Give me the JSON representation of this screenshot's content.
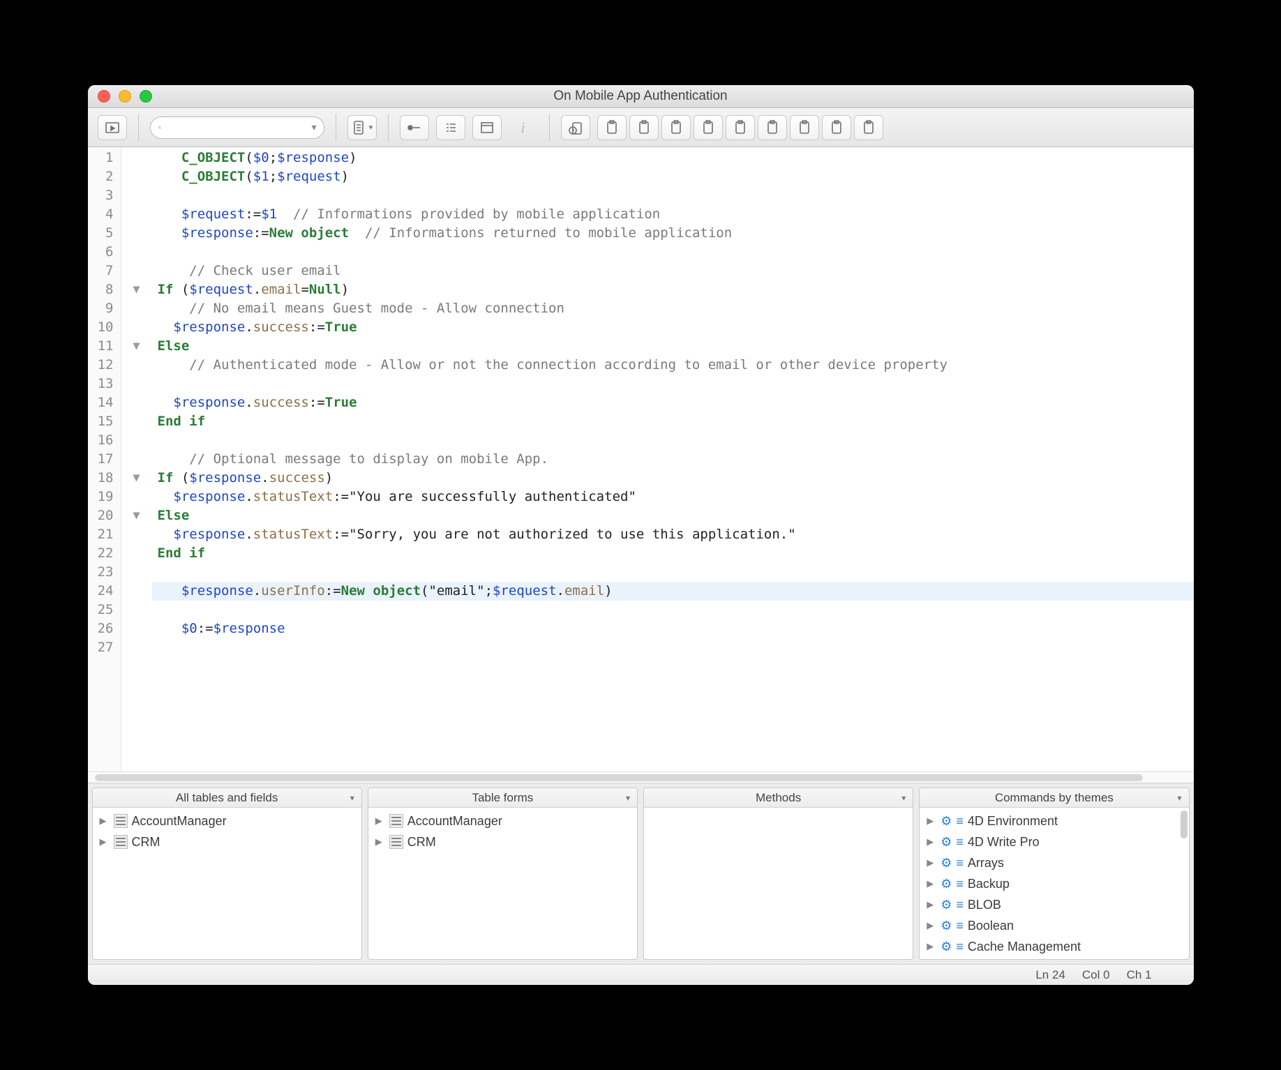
{
  "window": {
    "title": "On Mobile App Authentication"
  },
  "search": {
    "placeholder": ""
  },
  "code": {
    "total_lines": 27,
    "highlighted_line": 24,
    "fold_markers": {
      "8": "▼",
      "11": "▼",
      "18": "▼",
      "20": "▼"
    },
    "lines": [
      {
        "n": 1,
        "html": "   <span class='cmd'>C_OBJECT</span><span class='pun'>(</span><span class='var'>$0</span><span class='pun'>;</span><span class='var'>$response</span><span class='pun'>)</span>"
      },
      {
        "n": 2,
        "html": "   <span class='cmd'>C_OBJECT</span><span class='pun'>(</span><span class='var'>$1</span><span class='pun'>;</span><span class='var'>$request</span><span class='pun'>)</span>"
      },
      {
        "n": 3,
        "html": ""
      },
      {
        "n": 4,
        "html": "   <span class='var'>$request</span><span class='pun'>:=</span><span class='var'>$1</span>  <span class='cm'>// Informations provided by mobile application</span>"
      },
      {
        "n": 5,
        "html": "   <span class='var'>$response</span><span class='pun'>:=</span><span class='kw'>New object</span>  <span class='cm'>// Informations returned to mobile application</span>"
      },
      {
        "n": 6,
        "html": ""
      },
      {
        "n": 7,
        "html": "    <span class='cm'>// Check user email</span>"
      },
      {
        "n": 8,
        "html": "<span class='kw'>If</span> <span class='pun'>(</span><span class='var'>$request</span><span class='pun'>.</span><span class='prop'>email</span><span class='pun'>=</span><span class='kw'>Null</span><span class='pun'>)</span>"
      },
      {
        "n": 9,
        "html": "    <span class='cm'>// No email means Guest mode - Allow connection</span>"
      },
      {
        "n": 10,
        "html": "  <span class='var'>$response</span><span class='pun'>.</span><span class='prop'>success</span><span class='pun'>:=</span><span class='kw'>True</span>"
      },
      {
        "n": 11,
        "html": "<span class='kw'>Else</span>"
      },
      {
        "n": 12,
        "html": "    <span class='cm'>// Authenticated mode - Allow or not the connection according to email or other device property</span>"
      },
      {
        "n": 13,
        "html": ""
      },
      {
        "n": 14,
        "html": "  <span class='var'>$response</span><span class='pun'>.</span><span class='prop'>success</span><span class='pun'>:=</span><span class='kw'>True</span>"
      },
      {
        "n": 15,
        "html": "<span class='kw'>End if</span>"
      },
      {
        "n": 16,
        "html": ""
      },
      {
        "n": 17,
        "html": "    <span class='cm'>// Optional message to display on mobile App.</span>"
      },
      {
        "n": 18,
        "html": "<span class='kw'>If</span> <span class='pun'>(</span><span class='var'>$response</span><span class='pun'>.</span><span class='prop'>success</span><span class='pun'>)</span>"
      },
      {
        "n": 19,
        "html": "  <span class='var'>$response</span><span class='pun'>.</span><span class='prop'>statusText</span><span class='pun'>:=</span><span class='str'>\"You are successfully authenticated\"</span>"
      },
      {
        "n": 20,
        "html": "<span class='kw'>Else</span>"
      },
      {
        "n": 21,
        "html": "  <span class='var'>$response</span><span class='pun'>.</span><span class='prop'>statusText</span><span class='pun'>:=</span><span class='str'>\"Sorry, you are not authorized to use this application.\"</span>"
      },
      {
        "n": 22,
        "html": "<span class='kw'>End if</span>"
      },
      {
        "n": 23,
        "html": ""
      },
      {
        "n": 24,
        "html": "   <span class='var'>$response</span><span class='pun'>.</span><span class='prop'>userInfo</span><span class='pun'>:=</span><span class='kw'>New object</span><span class='pun'>(</span><span class='str'>\"email\"</span><span class='pun'>;</span><span class='var'>$request</span><span class='pun'>.</span><span class='prop'>email</span><span class='pun'>)</span>"
      },
      {
        "n": 25,
        "html": ""
      },
      {
        "n": 26,
        "html": "   <span class='var'>$0</span><span class='pun'>:=</span><span class='var'>$response</span>"
      },
      {
        "n": 27,
        "html": ""
      }
    ]
  },
  "panels": {
    "p1": {
      "title": "All tables and fields",
      "items": [
        "AccountManager",
        "CRM"
      ],
      "icon": "table"
    },
    "p2": {
      "title": "Table forms",
      "items": [
        "AccountManager",
        "CRM"
      ],
      "icon": "table"
    },
    "p3": {
      "title": "Methods",
      "items": [],
      "icon": "none"
    },
    "p4": {
      "title": "Commands by themes",
      "items": [
        "4D Environment",
        "4D Write Pro",
        "Arrays",
        "Backup",
        "BLOB",
        "Boolean",
        "Cache Management"
      ],
      "icon": "gear",
      "scroll": true
    }
  },
  "status": {
    "ln": "Ln 24",
    "col": "Col 0",
    "ch": "Ch 1"
  }
}
